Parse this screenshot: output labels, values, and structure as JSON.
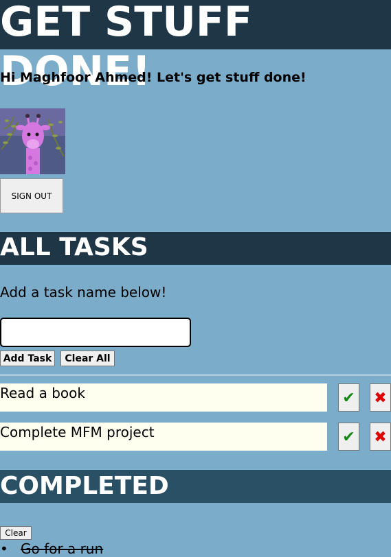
{
  "app": {
    "title": "GET STUFF DONE!",
    "greeting": "Hi Maghfoor Ahmed! Let's get stuff done!",
    "sign_out_label": "SIGN OUT"
  },
  "all_tasks": {
    "heading": "ALL TASKS",
    "hint": "Add a task name below!",
    "input_value": "",
    "add_label": "Add Task",
    "clear_all_label": "Clear All",
    "items": [
      {
        "label": "Read a book"
      },
      {
        "label": "Complete MFM project"
      }
    ],
    "complete_icon": "check-icon",
    "delete_icon": "x-icon"
  },
  "completed": {
    "heading": "COMPLETED",
    "clear_label": "Clear",
    "items": [
      {
        "label": "Go for a run"
      }
    ]
  },
  "colors": {
    "background": "#7bacca",
    "banner": "#1f3647",
    "task_bg": "#fffff0",
    "check": "#128a12",
    "x": "#e00000"
  }
}
